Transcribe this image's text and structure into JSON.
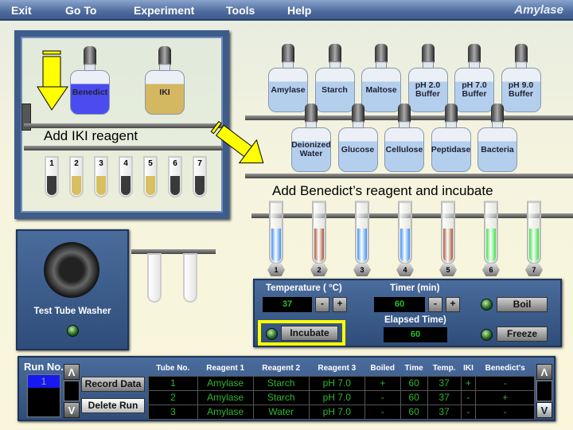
{
  "menu": {
    "items": [
      "Exit",
      "Go To",
      "Experiment",
      "Tools",
      "Help"
    ],
    "app_title": "Amylase"
  },
  "cabinet": {
    "bottles": [
      {
        "label": "Benedict",
        "color": "#4a4cf0"
      },
      {
        "label": "IKI",
        "color": "#d4b760"
      }
    ],
    "instruction": "Add IKI reagent",
    "tubes": [
      {
        "num": "1",
        "color": "#3a3a3a"
      },
      {
        "num": "2",
        "color": "#d8c060"
      },
      {
        "num": "3",
        "color": "#d8c060"
      },
      {
        "num": "4",
        "color": "#3a3a3a"
      },
      {
        "num": "5",
        "color": "#d8c060"
      },
      {
        "num": "6",
        "color": "#3a3a3a"
      },
      {
        "num": "7",
        "color": "#3a3a3a"
      }
    ]
  },
  "reagents": {
    "row1": [
      {
        "label": "Amylase"
      },
      {
        "label": "Starch"
      },
      {
        "label": "Maltose"
      },
      {
        "label": "pH 2.0 Buffer"
      },
      {
        "label": "pH 7.0 Buffer"
      },
      {
        "label": "pH 9.0 Buffer"
      }
    ],
    "row2": [
      {
        "label": "Deionized Water"
      },
      {
        "label": "Glucose"
      },
      {
        "label": "Cellulose"
      },
      {
        "label": "Peptidase"
      },
      {
        "label": "Bacteria"
      }
    ],
    "bottle_color": "#b4cfee"
  },
  "incubation": {
    "instruction": "Add Benedict’s reagent and incubate",
    "tubes": [
      {
        "num": "1",
        "color": "#3d8ff0"
      },
      {
        "num": "2",
        "color": "#a4573a"
      },
      {
        "num": "3",
        "color": "#3d8ff0"
      },
      {
        "num": "4",
        "color": "#3d8ff0"
      },
      {
        "num": "5",
        "color": "#a4573a"
      },
      {
        "num": "6",
        "color": "#3de04a"
      },
      {
        "num": "7",
        "color": "#3de04a"
      }
    ]
  },
  "washer": {
    "label": "Test Tube Washer"
  },
  "controls": {
    "temperature_label": "Temperature ( °C)",
    "temperature": "37",
    "timer_label": "Timer (min)",
    "timer": "60",
    "elapsed_label": "Elapsed Time)",
    "elapsed": "60",
    "minus": "-",
    "plus": "+",
    "boil": "Boil",
    "freeze": "Freeze",
    "incubate": "Incubate"
  },
  "results": {
    "run_label": "Run No.",
    "runs": [
      "1"
    ],
    "record": "Record Data",
    "delete": "Delete Run",
    "up": "Λ",
    "down": "V",
    "columns": [
      "Tube No.",
      "Reagent 1",
      "Reagent 2",
      "Reagent 3",
      "Boiled",
      "Time",
      "Temp.",
      "IKI",
      "Benedict's"
    ],
    "rows": [
      [
        "1",
        "Amylase",
        "Starch",
        "pH 7.0",
        "+",
        "60",
        "37",
        "+",
        "-"
      ],
      [
        "2",
        "Amylase",
        "Starch",
        "pH 7.0",
        "-",
        "60",
        "37",
        "-",
        "+"
      ],
      [
        "3",
        "Amylase",
        "Water",
        "pH 7.0",
        "-",
        "60",
        "37",
        "-",
        "-"
      ]
    ]
  }
}
